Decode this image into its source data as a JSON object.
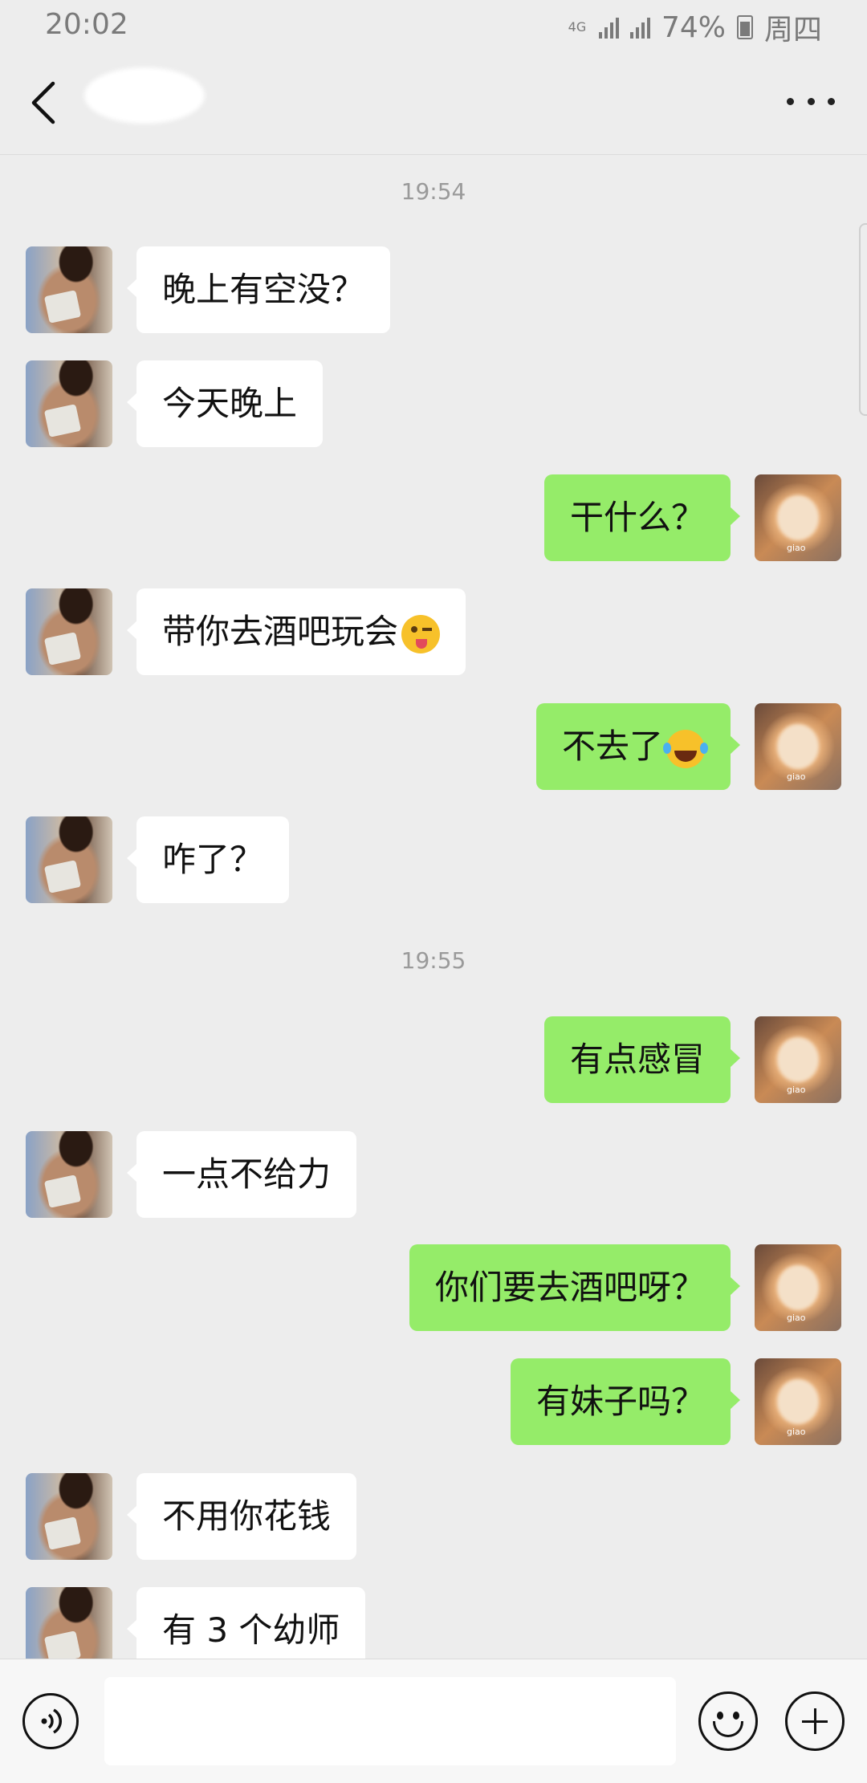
{
  "status_bar": {
    "time": "20:02",
    "network": "4G",
    "battery": "74%",
    "weekday": "周四"
  },
  "header": {
    "title": "",
    "more_icon": "more-icon",
    "back_icon": "back-icon"
  },
  "messages": [
    {
      "type": "time",
      "text": "19:54"
    },
    {
      "from": "friend",
      "text": "晚上有空没？"
    },
    {
      "from": "friend",
      "text": "今天晚上"
    },
    {
      "from": "me",
      "text": "干什么？"
    },
    {
      "from": "friend",
      "text": "带你去酒吧玩会",
      "emoji": "winking-tongue-emoji"
    },
    {
      "from": "me",
      "text": "不去了",
      "emoji": "crying-laughing-emoji"
    },
    {
      "from": "friend",
      "text": "咋了？"
    },
    {
      "type": "time",
      "text": "19:55"
    },
    {
      "from": "me",
      "text": "有点感冒"
    },
    {
      "from": "friend",
      "text": "一点不给力"
    },
    {
      "from": "me",
      "text": "你们要去酒吧呀？"
    },
    {
      "from": "me",
      "text": "有妹子吗？"
    },
    {
      "from": "friend",
      "text": "不用你花钱"
    },
    {
      "from": "friend",
      "text": "有 3 个幼师"
    }
  ],
  "my_avatar_caption": "giao",
  "input_bar": {
    "value": "",
    "voice_icon": "voice-icon",
    "emoji_icon": "emoji-icon",
    "plus_icon": "plus-icon"
  },
  "colors": {
    "background": "#ededed",
    "my_bubble": "#95ec69",
    "friend_bubble": "#ffffff"
  }
}
